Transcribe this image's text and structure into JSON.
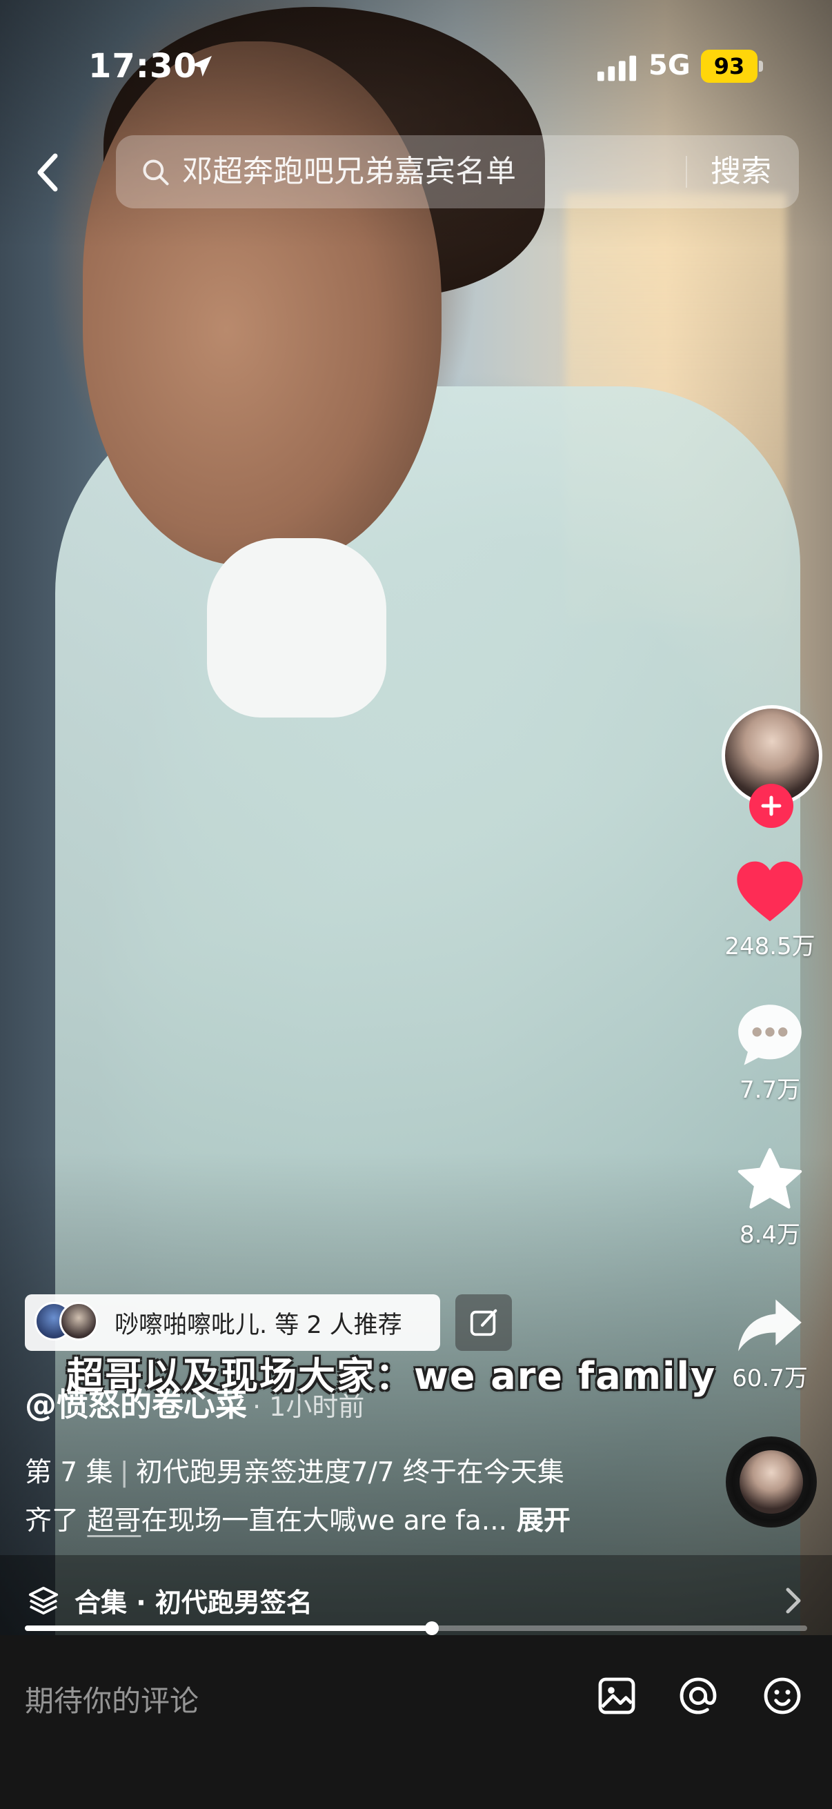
{
  "status_bar": {
    "time": "17:30",
    "network": "5G",
    "battery": "93"
  },
  "search": {
    "query": "邓超奔跑吧兄弟嘉宾名单",
    "button_label": "搜索"
  },
  "actions": {
    "likes": "248.5万",
    "comments": "7.7万",
    "favorites": "8.4万",
    "shares": "60.7万"
  },
  "recommend": {
    "text": "唦嚓啪嚓吡儿. 等 2 人推荐"
  },
  "video": {
    "subtitle": "超哥以及现场大家：we are family"
  },
  "post": {
    "author": "@愤怒的卷心菜",
    "time": "· 1小时前",
    "episode": "第 7 集",
    "desc_line1": "初代跑男亲签进度7/7 终于在今天集",
    "desc_line2_prefix": "齐了 ",
    "mention": "超哥",
    "desc_line2_suffix": "在现场一直在大喊we are fa...",
    "expand": "展开"
  },
  "collection": {
    "label": "合集 · 初代跑男签名"
  },
  "playback": {
    "progress": 0.52
  },
  "comment_bar": {
    "placeholder": "期待你的评论"
  },
  "colors": {
    "like": "#fe2c55",
    "battery": "#ffd60a",
    "follow": "#fe2c55"
  }
}
